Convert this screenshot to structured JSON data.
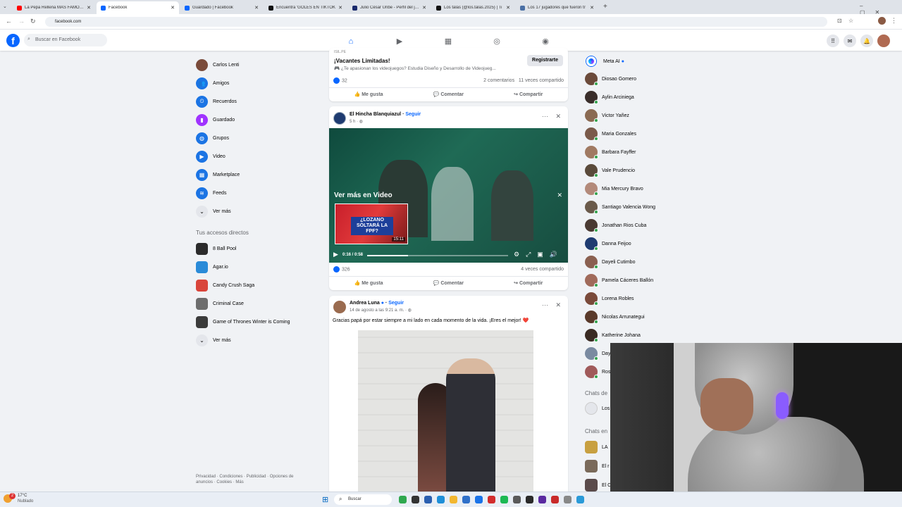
{
  "browser": {
    "tabs": [
      {
        "title": "La Pepa Rellena MÁS FAMOSA",
        "color": "#ff0000",
        "active": false
      },
      {
        "title": "Facebook",
        "color": "#0866ff",
        "active": true
      },
      {
        "title": "Guardado | Facebook",
        "color": "#0866ff",
        "active": false
      },
      {
        "title": "Encuentra 'GOLES EN TIKTOK",
        "color": "#111111",
        "active": false
      },
      {
        "title": "Julio César Uribe - Perfil del jug",
        "color": "#1a2a6c",
        "active": false
      },
      {
        "title": "Los talas (@los.talas.2025) | Ti",
        "color": "#111111",
        "active": false
      },
      {
        "title": "Los 17 jugadores que fueron tr",
        "color": "#4a6fa5",
        "active": false
      }
    ],
    "url": "facebook.com",
    "new_tab": "+"
  },
  "fb": {
    "logo": "f",
    "search_placeholder": "Buscar en Facebook",
    "nav_icons": [
      "home-icon",
      "video-icon",
      "marketplace-icon",
      "groups-icon",
      "gaming-icon"
    ]
  },
  "left_menu": {
    "items": [
      {
        "label": "Carlos Lenti",
        "icon": "avatar",
        "color": "#7a4b3a"
      },
      {
        "label": "Amigos",
        "icon": "friends-icon",
        "color": "#1b74e4"
      },
      {
        "label": "Recuerdos",
        "icon": "memories-icon",
        "color": "#1b74e4"
      },
      {
        "label": "Guardado",
        "icon": "saved-icon",
        "color": "#a033ff"
      },
      {
        "label": "Grupos",
        "icon": "groups-icon",
        "color": "#1b74e4"
      },
      {
        "label": "Video",
        "icon": "video-icon",
        "color": "#1b74e4"
      },
      {
        "label": "Marketplace",
        "icon": "marketplace-icon",
        "color": "#1b74e4"
      },
      {
        "label": "Feeds",
        "icon": "feeds-icon",
        "color": "#1b74e4"
      },
      {
        "label": "Ver más",
        "icon": "chevron-down-icon",
        "color": "#e4e6eb"
      }
    ],
    "shortcuts_title": "Tus accesos directos",
    "shortcuts": [
      {
        "label": "8 Ball Pool",
        "color": "#2b2b2b"
      },
      {
        "label": "Agar.io",
        "color": "#2a8bd8"
      },
      {
        "label": "Candy Crush Saga",
        "color": "#d9453b"
      },
      {
        "label": "Criminal Case",
        "color": "#6d6d6d"
      },
      {
        "label": "Game of Thrones Winter is Coming",
        "color": "#3b3b3b"
      },
      {
        "label": "Ver más",
        "color": "#e4e6eb"
      }
    ],
    "footer": [
      "Privacidad",
      "Condiciones",
      "Publicidad",
      "Opciones de anuncios",
      "Cookies",
      "Más"
    ]
  },
  "feed": {
    "post1": {
      "source": "ISIL.PE",
      "headline": "¡Vacantes Limitadas!",
      "subtext": "🎮 ¿Te apasionan los videojuegos? Estudia Diseño y Desarrollo de Videojueg...",
      "cta": "Registrarte",
      "likes": "32",
      "comments": "2 comentarios",
      "shares": "11 veces compartido"
    },
    "post2": {
      "author": "El Hincha Blanquiazul",
      "follow": "Seguir",
      "time": "5 h",
      "overlay_title": "Ver más en Video",
      "thumb_text": "¿LOZANO SOLTARÁ LA FPF?",
      "thumb_duration": "15:11",
      "progress_time": "0:16 / 0:58",
      "progress": 0.29,
      "likes": "326",
      "shares": "4 veces compartido"
    },
    "post3": {
      "author": "Andrea Luna",
      "follow": "Seguir",
      "time": "14 de agosto a las 9:21 a. m.",
      "text": "Gracias papá por estar siempre a mi lado en cada momento de la vida. ¡Eres el mejor! ❤️"
    },
    "actions": {
      "like": "Me gusta",
      "comment": "Comentar",
      "share": "Compartir"
    }
  },
  "contacts": {
    "meta_ai": "Meta AI",
    "people": [
      "Diosao Gomero",
      "Aylin Arciniega",
      "Victor Yañez",
      "Maria Gonzales",
      "Barbara Fayffer",
      "Vale Prudencio",
      "Mia Mercury Bravo",
      "Santiago Valencia Wong",
      "Jonathan Rios Cuba",
      "Danna Feijoo",
      "Dayeli Cutimbo",
      "Pamela Cáceres Ballón",
      "Lorena Robles",
      "Nicolas Arrunategui",
      "Katherine Johana",
      "Day",
      "Ros"
    ],
    "group_title": "Chats de",
    "group_item": "Los",
    "community_title": "Chats en",
    "community_items": [
      "LA",
      "El r",
      "El C"
    ]
  },
  "taskbar": {
    "weather_temp": "17°C",
    "weather_desc": "Nublado",
    "notif_count": "2",
    "search": "Buscar"
  }
}
